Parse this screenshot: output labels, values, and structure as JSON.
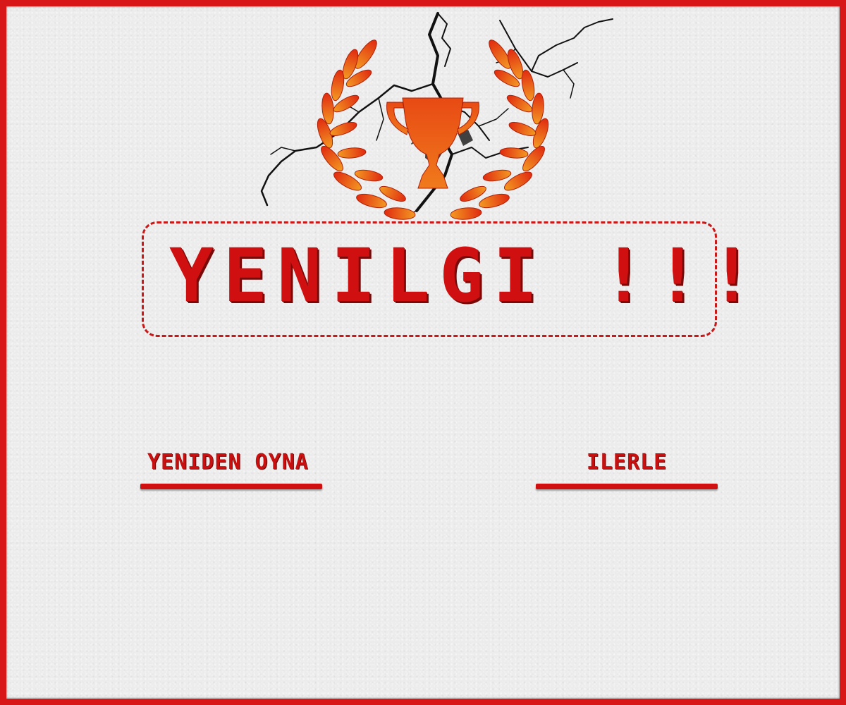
{
  "screen": {
    "title": "YENILGI !!!",
    "emblem_icon": "trophy-laurel-icon",
    "accent_color": "#d01010",
    "emblem_colors": [
      "#e03010",
      "#f08a20"
    ]
  },
  "buttons": {
    "replay_label": "YENIDEN OYNA",
    "next_label": "ILERLE"
  }
}
